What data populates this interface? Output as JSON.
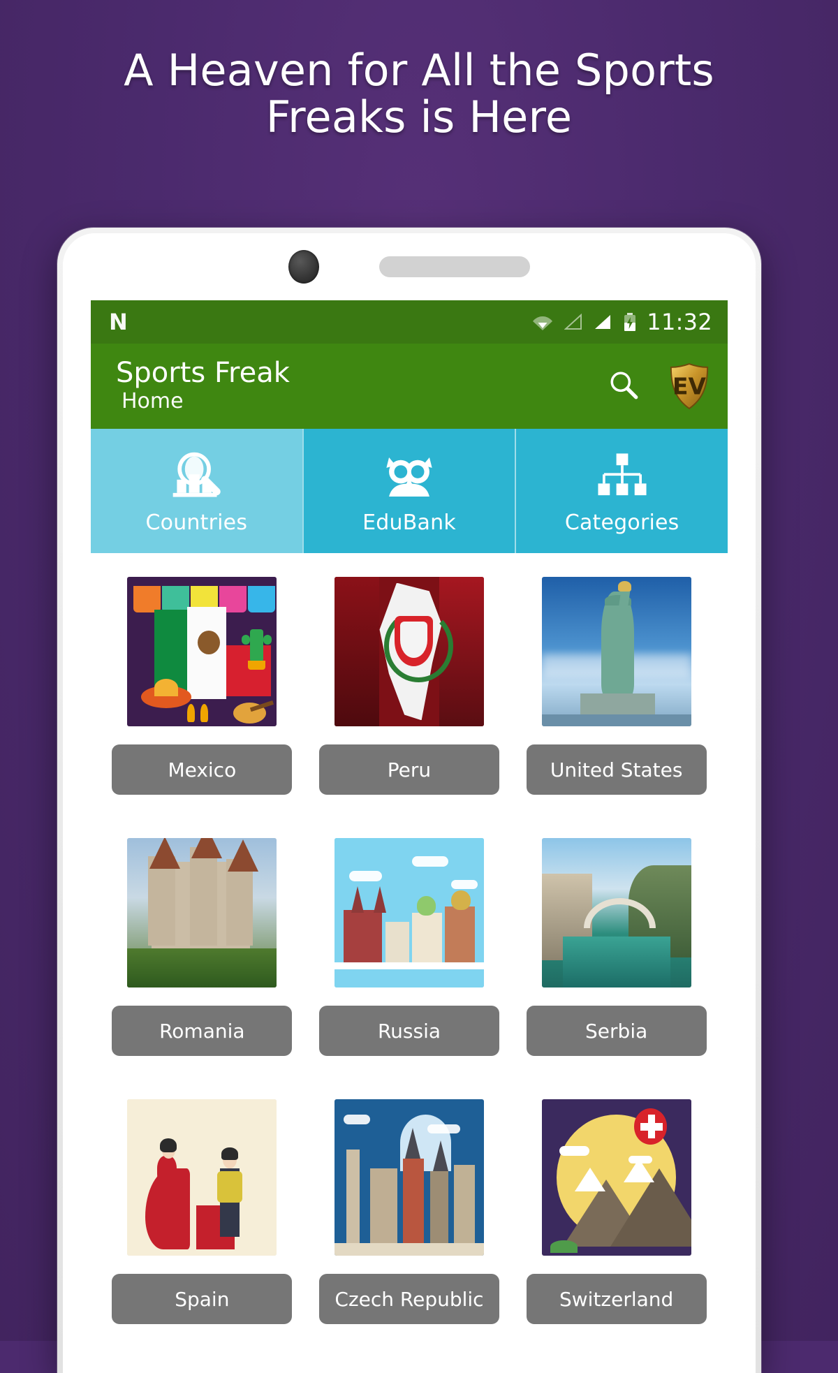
{
  "promo": {
    "headline_line1": "A Heaven for All the Sports",
    "headline_line2": "Freaks is Here",
    "background_color": "#4C2A6E"
  },
  "statusbar": {
    "os_logo": "android-n-logo",
    "icons": [
      "wifi-icon",
      "signal-empty-icon",
      "signal-full-icon",
      "battery-charging-icon"
    ],
    "time": "11:32",
    "background_color": "#3A7812"
  },
  "appbar": {
    "title": "Sports Freak",
    "subtitle": "Home",
    "search_icon": "search-icon",
    "brand_logo_text": "EV",
    "background_color": "#3F8711"
  },
  "tabs": [
    {
      "label": "Countries",
      "icon": "magnifier-city-icon",
      "active": true,
      "color": "#74CFE3"
    },
    {
      "label": "EduBank",
      "icon": "owl-icon",
      "active": false,
      "color": "#2CB4D1"
    },
    {
      "label": "Categories",
      "icon": "hierarchy-icon",
      "active": false,
      "color": "#2CB4D1"
    }
  ],
  "grid": {
    "chip_color": "#767676",
    "items": [
      {
        "label": "Mexico",
        "art": "mx"
      },
      {
        "label": "Peru",
        "art": "pe"
      },
      {
        "label": "United States",
        "art": "us"
      },
      {
        "label": "Romania",
        "art": "ro"
      },
      {
        "label": "Russia",
        "art": "ru"
      },
      {
        "label": "Serbia",
        "art": "rs"
      },
      {
        "label": "Spain",
        "art": "es"
      },
      {
        "label": "Czech Republic",
        "art": "cz"
      },
      {
        "label": "Switzerland",
        "art": "ch"
      }
    ]
  }
}
